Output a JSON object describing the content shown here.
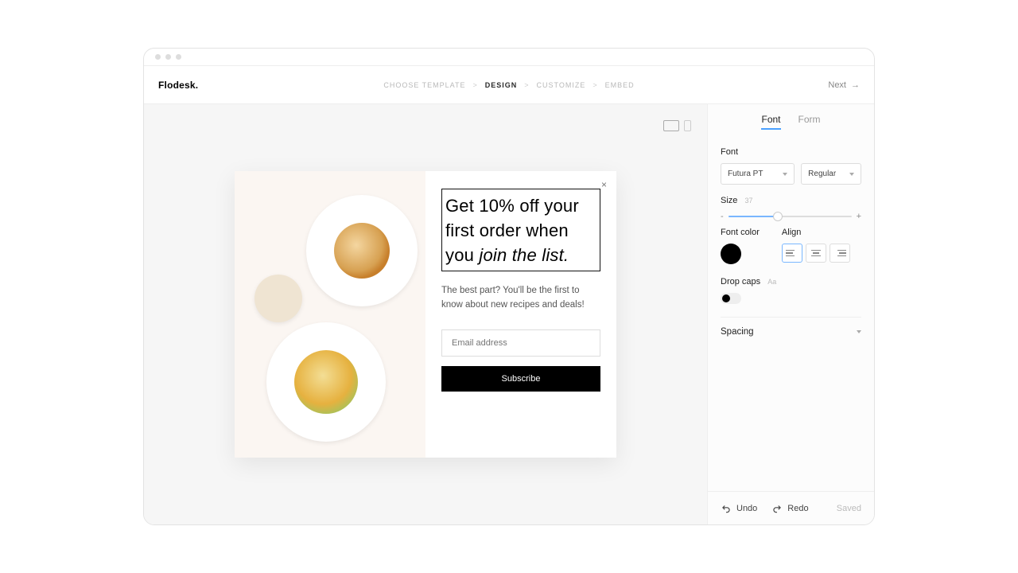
{
  "app": {
    "logo": "Flodesk."
  },
  "breadcrumbs": {
    "items": [
      "CHOOSE TEMPLATE",
      "DESIGN",
      "CUSTOMIZE",
      "EMBED"
    ],
    "active_index": 1,
    "sep": ">"
  },
  "header": {
    "next": "Next"
  },
  "form": {
    "headline_plain": "Get 10% off your first order when you ",
    "headline_italic": "join the list.",
    "subtext": "The best part? You'll be the first to know about new recipes and deals!",
    "email_placeholder": "Email address",
    "subscribe": "Subscribe",
    "close": "×"
  },
  "sidebar": {
    "tabs": {
      "font": "Font",
      "form": "Form",
      "active": "font"
    },
    "font": {
      "label": "Font",
      "family": "Futura PT",
      "weight": "Regular",
      "size_label": "Size",
      "size_value": "37",
      "slider_minus": "-",
      "slider_plus": "+",
      "color_label": "Font color",
      "color": "#000000",
      "align_label": "Align",
      "dropcaps_label": "Drop caps",
      "dropcaps_hint": "Aa",
      "spacing_label": "Spacing"
    }
  },
  "footer": {
    "undo": "Undo",
    "redo": "Redo",
    "saved": "Saved"
  }
}
